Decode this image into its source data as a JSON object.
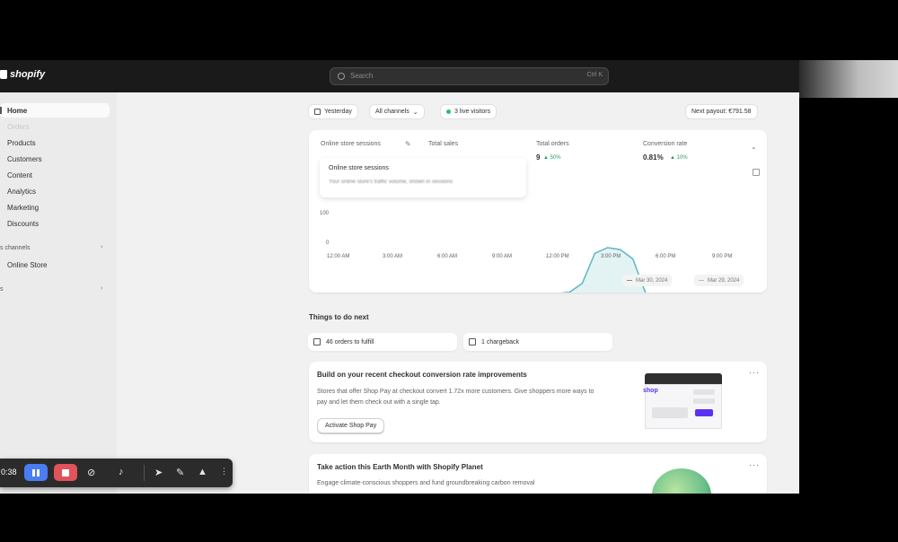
{
  "topbar": {
    "brand": "shopify",
    "search_placeholder": "Search",
    "search_shortcut": "Ctrl K"
  },
  "sidebar": {
    "items": [
      {
        "label": "Home",
        "active": true
      },
      {
        "label": "Orders",
        "faded": true
      },
      {
        "label": "Products"
      },
      {
        "label": "Customers"
      },
      {
        "label": "Content"
      },
      {
        "label": "Analytics"
      },
      {
        "label": "Marketing"
      },
      {
        "label": "Discounts"
      }
    ],
    "sales_channels_label": "s channels",
    "channels": [
      {
        "label": "Online Store"
      }
    ],
    "apps_label": "s"
  },
  "filters": {
    "date": "Yesterday",
    "channels": "All channels",
    "live_visitors": "3 live visitors",
    "next_payout": "Next payout: €791.58"
  },
  "metrics": {
    "sessions_label": "Online store sessions",
    "total_sales_label": "Total sales",
    "total_orders_label": "Total orders",
    "total_orders_value": "9",
    "total_orders_change": "▲ 50%",
    "conversion_label": "Conversion rate",
    "conversion_value": "0.81%",
    "conversion_change": "▲ 10%"
  },
  "dropdown": {
    "title": "Online store sessions",
    "subtitle": "Your online store's traffic volume, shown in sessions"
  },
  "chart_data": {
    "type": "area",
    "x": [
      "12:00 AM",
      "3:00 AM",
      "6:00 AM",
      "9:00 AM",
      "12:00 PM",
      "3:00 PM",
      "6:00 PM",
      "9:00 PM"
    ],
    "ytick_labels": [
      "100",
      "0"
    ],
    "ylim": [
      0,
      200
    ],
    "series": [
      {
        "name": "Mar 30, 2024",
        "values": [
          8,
          10,
          6,
          5,
          5,
          4,
          4,
          5,
          6,
          6,
          8,
          10,
          12,
          14,
          14,
          16,
          22,
          28,
          32,
          55,
          135,
          150,
          145,
          120,
          30,
          22,
          18,
          14,
          15,
          10,
          9,
          8,
          7,
          8
        ]
      }
    ],
    "legend": [
      "Mar 30, 2024",
      "Mar 29, 2024"
    ],
    "grid": false
  },
  "todo": {
    "title": "Things to do next",
    "items": [
      "46 orders to fulfill",
      "1 chargeback"
    ]
  },
  "promo1": {
    "title": "Build on your recent checkout conversion rate improvements",
    "body": "Stores that offer Shop Pay at checkout convert 1.72x more customers. Give shoppers more ways to pay and let them check out with a single tap.",
    "button": "Activate Shop Pay",
    "illus_logo": "shop"
  },
  "promo2": {
    "title": "Take action this Earth Month with Shopify Planet",
    "body": "Engage climate-conscious shoppers and fund groundbreaking carbon removal"
  },
  "recorder": {
    "time": "0:38"
  }
}
